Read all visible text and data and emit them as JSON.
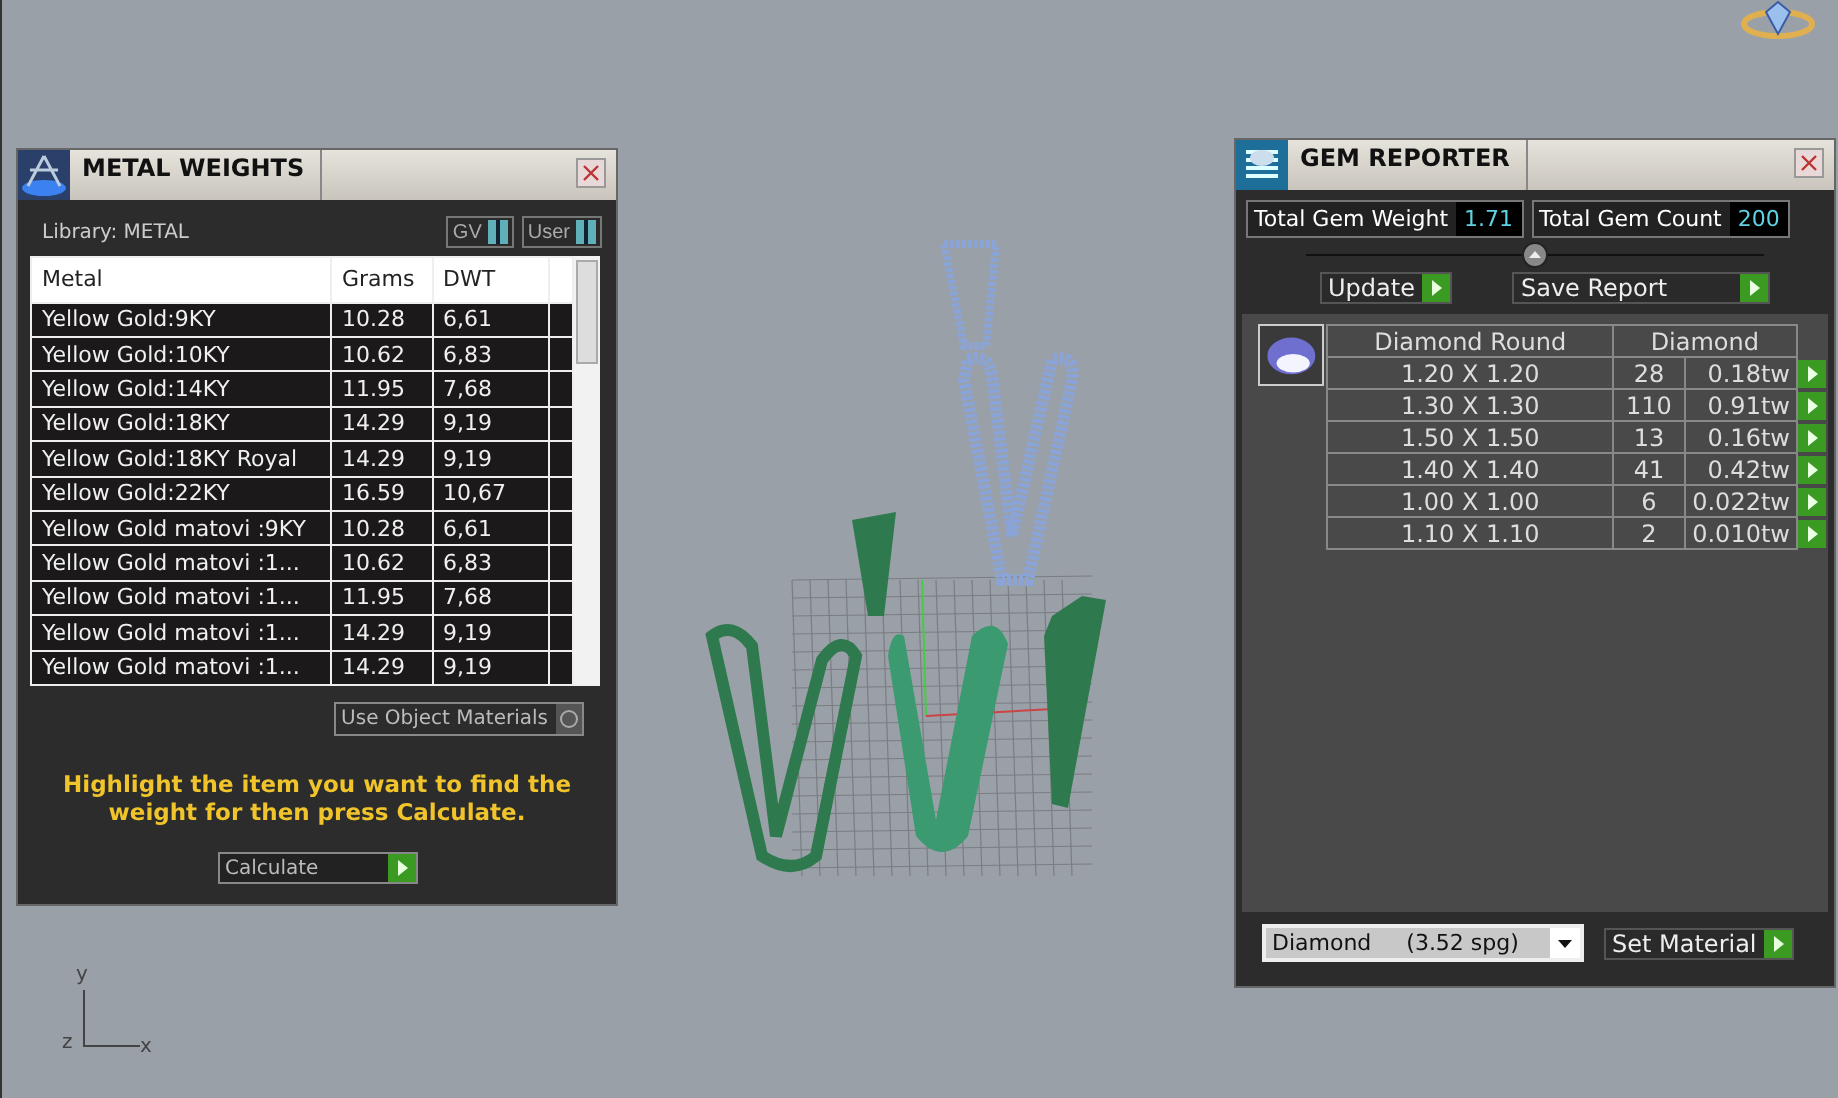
{
  "metal_weights": {
    "title": "METAL WEIGHTS",
    "library": "Library: METAL",
    "toggles": [
      {
        "label": "GV",
        "on": true
      },
      {
        "label": "User",
        "on": true
      }
    ],
    "columns": [
      "Metal",
      "Grams",
      "DWT"
    ],
    "rows": [
      {
        "metal": "Yellow Gold:9KY",
        "grams": "10.28",
        "dwt": "6,61"
      },
      {
        "metal": "Yellow Gold:10KY",
        "grams": "10.62",
        "dwt": "6,83"
      },
      {
        "metal": "Yellow Gold:14KY",
        "grams": "11.95",
        "dwt": "7,68"
      },
      {
        "metal": "Yellow Gold:18KY",
        "grams": "14.29",
        "dwt": "9,19"
      },
      {
        "metal": "Yellow Gold:18KY Royal",
        "grams": "14.29",
        "dwt": "9,19"
      },
      {
        "metal": "Yellow Gold:22KY",
        "grams": "16.59",
        "dwt": "10,67"
      },
      {
        "metal": "Yellow Gold matovi :9KY",
        "grams": "10.28",
        "dwt": "6,61"
      },
      {
        "metal": "Yellow Gold matovi :1...",
        "grams": "10.62",
        "dwt": "6,83"
      },
      {
        "metal": "Yellow Gold matovi :1...",
        "grams": "11.95",
        "dwt": "7,68"
      },
      {
        "metal": "Yellow Gold matovi :1...",
        "grams": "14.29",
        "dwt": "9,19"
      },
      {
        "metal": "Yellow Gold matovi :1...",
        "grams": "14.29",
        "dwt": "9,19"
      }
    ],
    "use_object_materials": {
      "label": "Use Object Materials",
      "checked": false
    },
    "hint": "Highlight the item you want to find the weight for then press Calculate.",
    "calculate_button": "Calculate"
  },
  "gem_reporter": {
    "title": "GEM REPORTER",
    "total_weight_label": "Total Gem Weight",
    "total_weight": "1.71",
    "total_count_label": "Total Gem Count",
    "total_count": "200",
    "buttons": [
      "Update",
      "Save Report"
    ],
    "columns": [
      "Diamond Round",
      "Diamond"
    ],
    "rows": [
      {
        "size": "1.20 X 1.20",
        "count": "28",
        "weight": "0.18tw"
      },
      {
        "size": "1.30 X 1.30",
        "count": "110",
        "weight": "0.91tw"
      },
      {
        "size": "1.50 X 1.50",
        "count": "13",
        "weight": "0.16tw"
      },
      {
        "size": "1.40 X 1.40",
        "count": "41",
        "weight": "0.42tw"
      },
      {
        "size": "1.00 X 1.00",
        "count": "6",
        "weight": "0.022tw"
      },
      {
        "size": "1.10 X 1.10",
        "count": "2",
        "weight": "0.010tw"
      }
    ],
    "material": "Diamond     (3.52 spg)",
    "set_material_button": "Set Material"
  },
  "axes": [
    "y",
    "z",
    "x"
  ]
}
